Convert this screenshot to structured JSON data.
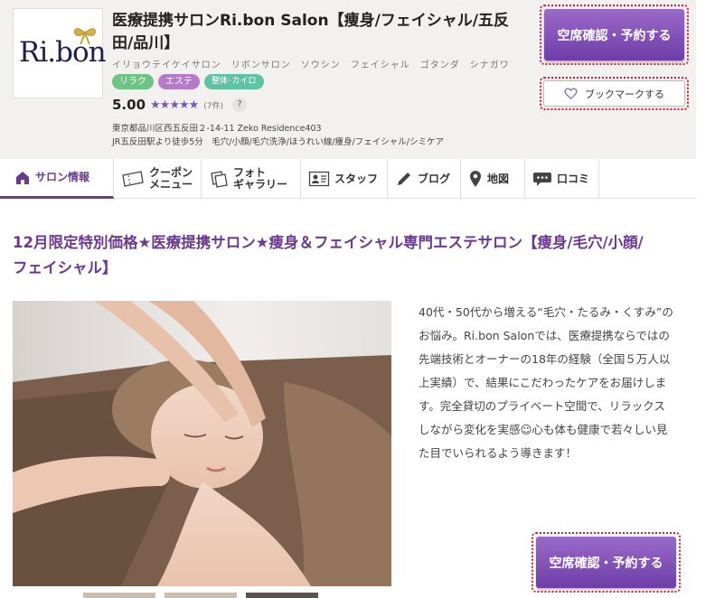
{
  "salon": {
    "logo_text": "Ri.bon",
    "name": "医療提携サロンRi.bon Salon【痩身/フェイシャル/五反田/品川】",
    "kana": "イリョウテイケイサロン　リボンサロン　ソウシン　フェイシャル　ゴタンダ　シナガワ",
    "tags": [
      "リラク",
      "エステ",
      "整体･カイロ"
    ],
    "rating": "5.00",
    "stars": "★★★★★",
    "review_count": "(7件)",
    "help": "?",
    "address": "東京都品川区西五反田２-14-11 Zeko Residence403",
    "access": "JR五反田駅より徒歩5分　毛穴/小顔/毛穴洗浄/ほうれい線/痩身/フェイシャル/シミケア"
  },
  "buttons": {
    "reserve": "空席確認・予約する",
    "bookmark": "ブックマークする"
  },
  "nav": [
    {
      "label": "サロン情報",
      "icon": "home-icon"
    },
    {
      "label": "クーポン\nメニュー",
      "icon": "coupon-icon"
    },
    {
      "label": "フォト\nギャラリー",
      "icon": "photo-icon"
    },
    {
      "label": "スタッフ",
      "icon": "staff-icon"
    },
    {
      "label": "ブログ",
      "icon": "pen-icon"
    },
    {
      "label": "地図",
      "icon": "map-pin-icon"
    },
    {
      "label": "口コミ",
      "icon": "chat-icon"
    }
  ],
  "content": {
    "catch": "12月限定特別価格★医療提携サロン★痩身＆フェイシャル専門エステサロン【痩身/毛穴/小顔/フェイシャル】",
    "description": "40代・50代から増える“毛穴・たるみ・くすみ”のお悩み。Ri.bon Salonでは、医療提携ならではの先端技術とオーナーの18年の経験（全国５万人以上実績）で、結果にこだわったケアをお届けします。完全貸切のプライベート空間で、リラックスしながら変化を実感☺心も体も健康で若々しい見た目でいられるよう導きます！"
  },
  "colors": {
    "accent": "#6b3a8f",
    "button": "#8652bd",
    "tag_green": "#6cc383",
    "tag_purple": "#b57bc9"
  }
}
